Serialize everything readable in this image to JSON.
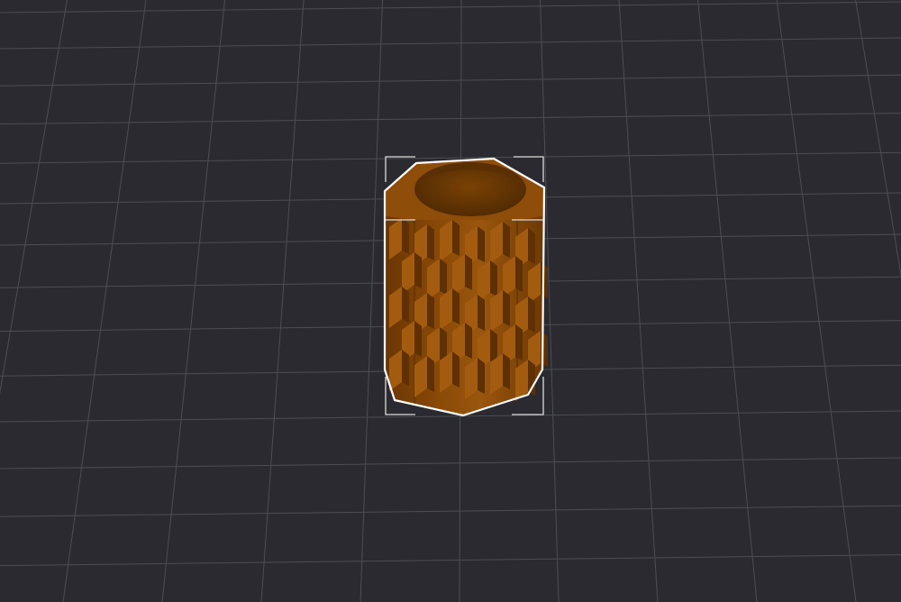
{
  "viewport": {
    "background_color": "#2a2a30",
    "grid_color": "#4d4e55",
    "grid_visible": true
  },
  "object": {
    "shape": "textured hexagonal vase",
    "selected": true,
    "color_main": "#8a4a06",
    "color_light": "#a35c0f",
    "color_dark": "#5e3003",
    "color_inner": "#6b3805",
    "outline_color": "#ffffff"
  },
  "selection_box": {
    "visible": true,
    "corner_color": "#dcdcdc"
  }
}
